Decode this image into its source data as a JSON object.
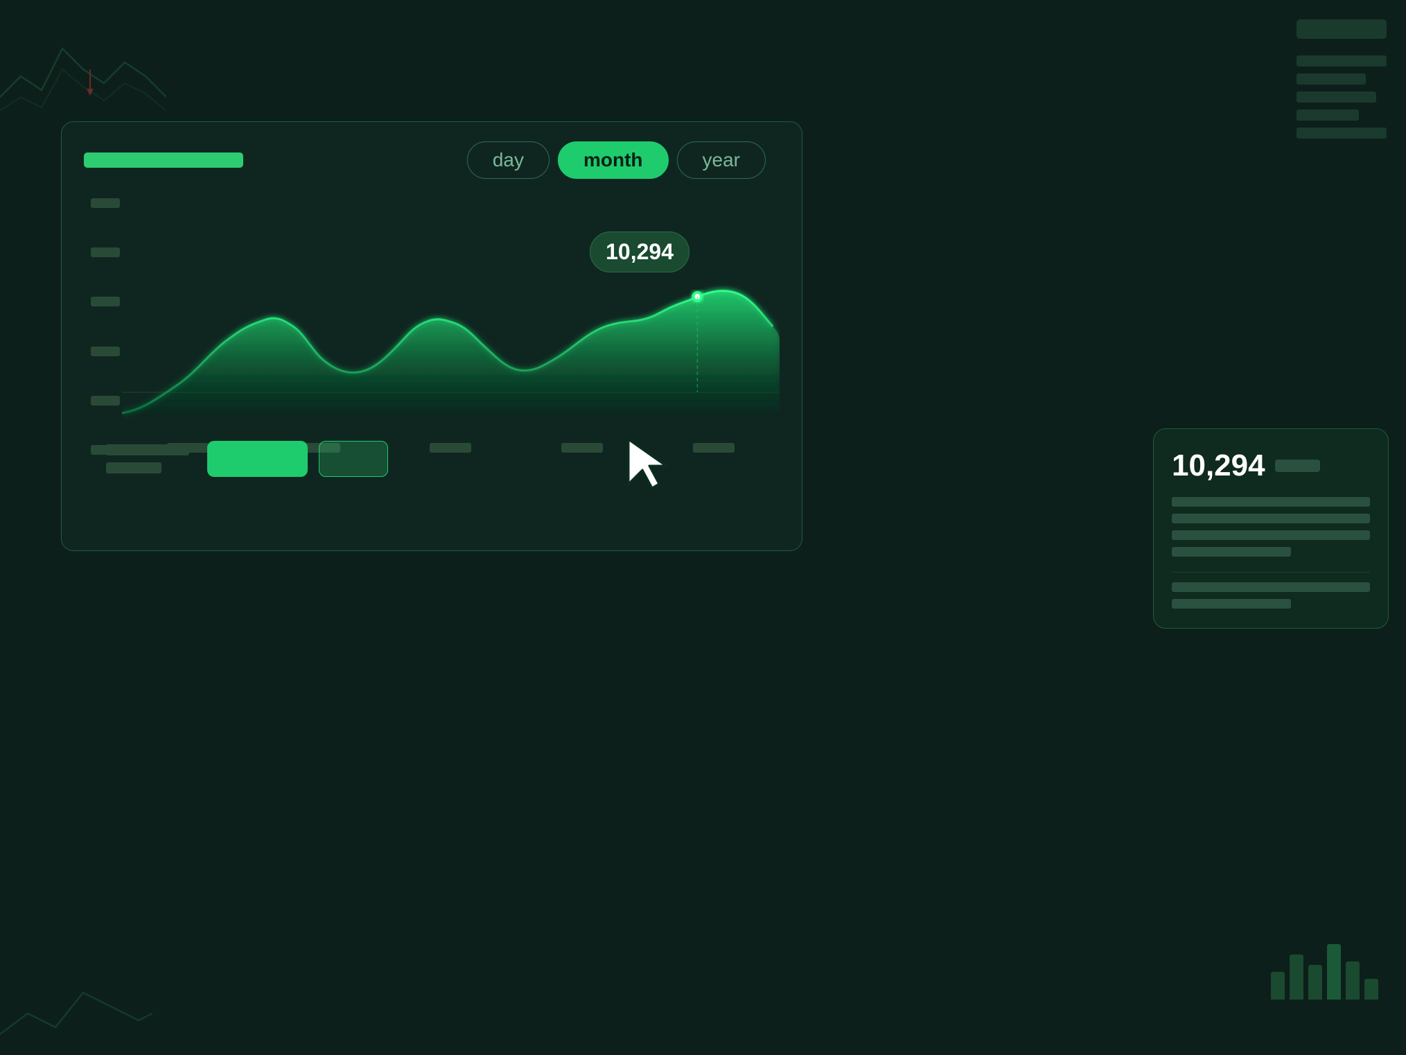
{
  "background": {
    "color": "#0d1f1a"
  },
  "header_bar": {
    "color": "#2ecc71"
  },
  "time_tabs": {
    "options": [
      {
        "id": "day",
        "label": "day",
        "active": false
      },
      {
        "id": "month",
        "label": "month",
        "active": true
      },
      {
        "id": "year",
        "label": "year",
        "active": false
      }
    ]
  },
  "chart": {
    "tooltip_bubble_value": "10,294",
    "y_axis_labels": [
      "",
      "",
      "",
      "",
      "",
      ""
    ],
    "x_axis_labels": [
      "",
      "",
      "",
      "",
      ""
    ]
  },
  "tooltip_card": {
    "value": "10,294"
  },
  "footer": {
    "btn_primary_label": "",
    "btn_secondary_label": ""
  }
}
